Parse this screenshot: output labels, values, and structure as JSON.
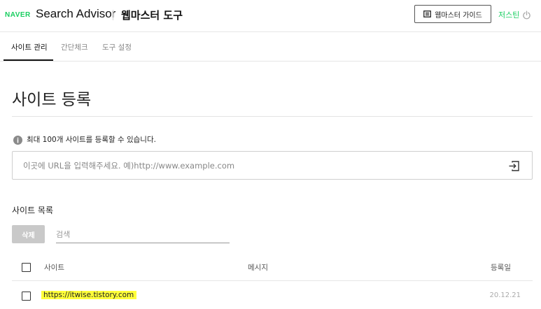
{
  "header": {
    "brand": "NAVER",
    "product": "Search Advisor",
    "subtitle": "웹마스터 도구",
    "guide_button": "웹마스터 가이드",
    "user_name": "저스틴",
    "icons": {
      "guide": "book-icon",
      "logout": "power-icon"
    }
  },
  "tabs": [
    {
      "label": "사이트 관리",
      "active": true
    },
    {
      "label": "간단체크",
      "active": false
    },
    {
      "label": "도구 설정",
      "active": false
    }
  ],
  "page_title": "사이트 등록",
  "notice": "최대 100개 사이트를 등록할 수 있습니다.",
  "url_input": {
    "placeholder": "이곳에 URL을 입력해주세요. 예)http://www.example.com",
    "value": ""
  },
  "site_list": {
    "title": "사이트 목록",
    "delete_button": "삭제",
    "search_placeholder": "검색",
    "columns": {
      "site": "사이트",
      "message": "메시지",
      "registered": "등록일"
    },
    "rows": [
      {
        "site": "https://itwise.tistory.com",
        "message": "",
        "registered": "20.12.21",
        "highlighted": true
      }
    ]
  },
  "colors": {
    "accent_green": "#19ce60",
    "highlight": "#ffff3a",
    "delete_button_disabled": "#c9c9c9"
  }
}
